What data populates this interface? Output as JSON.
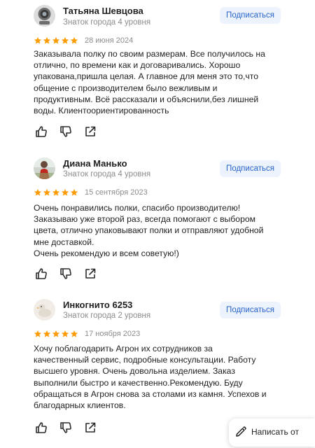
{
  "reviews": [
    {
      "author": "Татьяна Шевцова",
      "level": "Знаток города 4 уровня",
      "subscribe_label": "Подписаться",
      "rating": 5,
      "date": "28 июня 2024",
      "text_lines": [
        "Заказывала полку по своим размерам. Все получилось на",
        "отлично, по времени как и договаривались. Хорошо",
        "упакована,пришла целая. А главное для меня это то,что",
        "общение с производителем было вежливым и",
        "продуктивным. Всё рассказали и объяснили,без лишней",
        "воды. Клиентоориентированность"
      ]
    },
    {
      "author": "Диана Манько",
      "level": "Знаток города 4 уровня",
      "subscribe_label": "Подписаться",
      "rating": 5,
      "date": "15 сентября 2023",
      "text_lines": [
        "Очень понравились полки, спасибо производителю!",
        "Заказываю уже второй раз, всегда помогают с выбором",
        "цвета, отлично упаковывают полки и отправляют удобной",
        "мне доставкой.",
        "Очень рекомендую и всем советую!)"
      ]
    },
    {
      "author": "Инкогнито 6253",
      "level": "Знаток города 2 уровня",
      "subscribe_label": "Подписаться",
      "rating": 5,
      "date": "17 ноября 2023",
      "text_lines": [
        "Хочу поблагодарить Агрон их сотрудников за",
        "качественный сервис, подробные консультации. Работу",
        "высшего уровня. Очень довольна изделием. Заказ",
        "выполнили быстро и качественно.Рекомендую. Буду",
        "обращаться в Агрон снова за столами из камня. Успехов и",
        "благодарных клиентов."
      ]
    }
  ],
  "write_review": {
    "label": "Написать от",
    "icon": "pen-icon"
  },
  "colors": {
    "star": "#fc9b04",
    "subscribe_bg": "#ecf3fd",
    "subscribe_text": "#2a64c9",
    "muted_text": "#8c8c8c"
  },
  "icons": {
    "like": "thumbs-up-icon",
    "dislike": "thumbs-down-icon",
    "share": "share-icon"
  }
}
